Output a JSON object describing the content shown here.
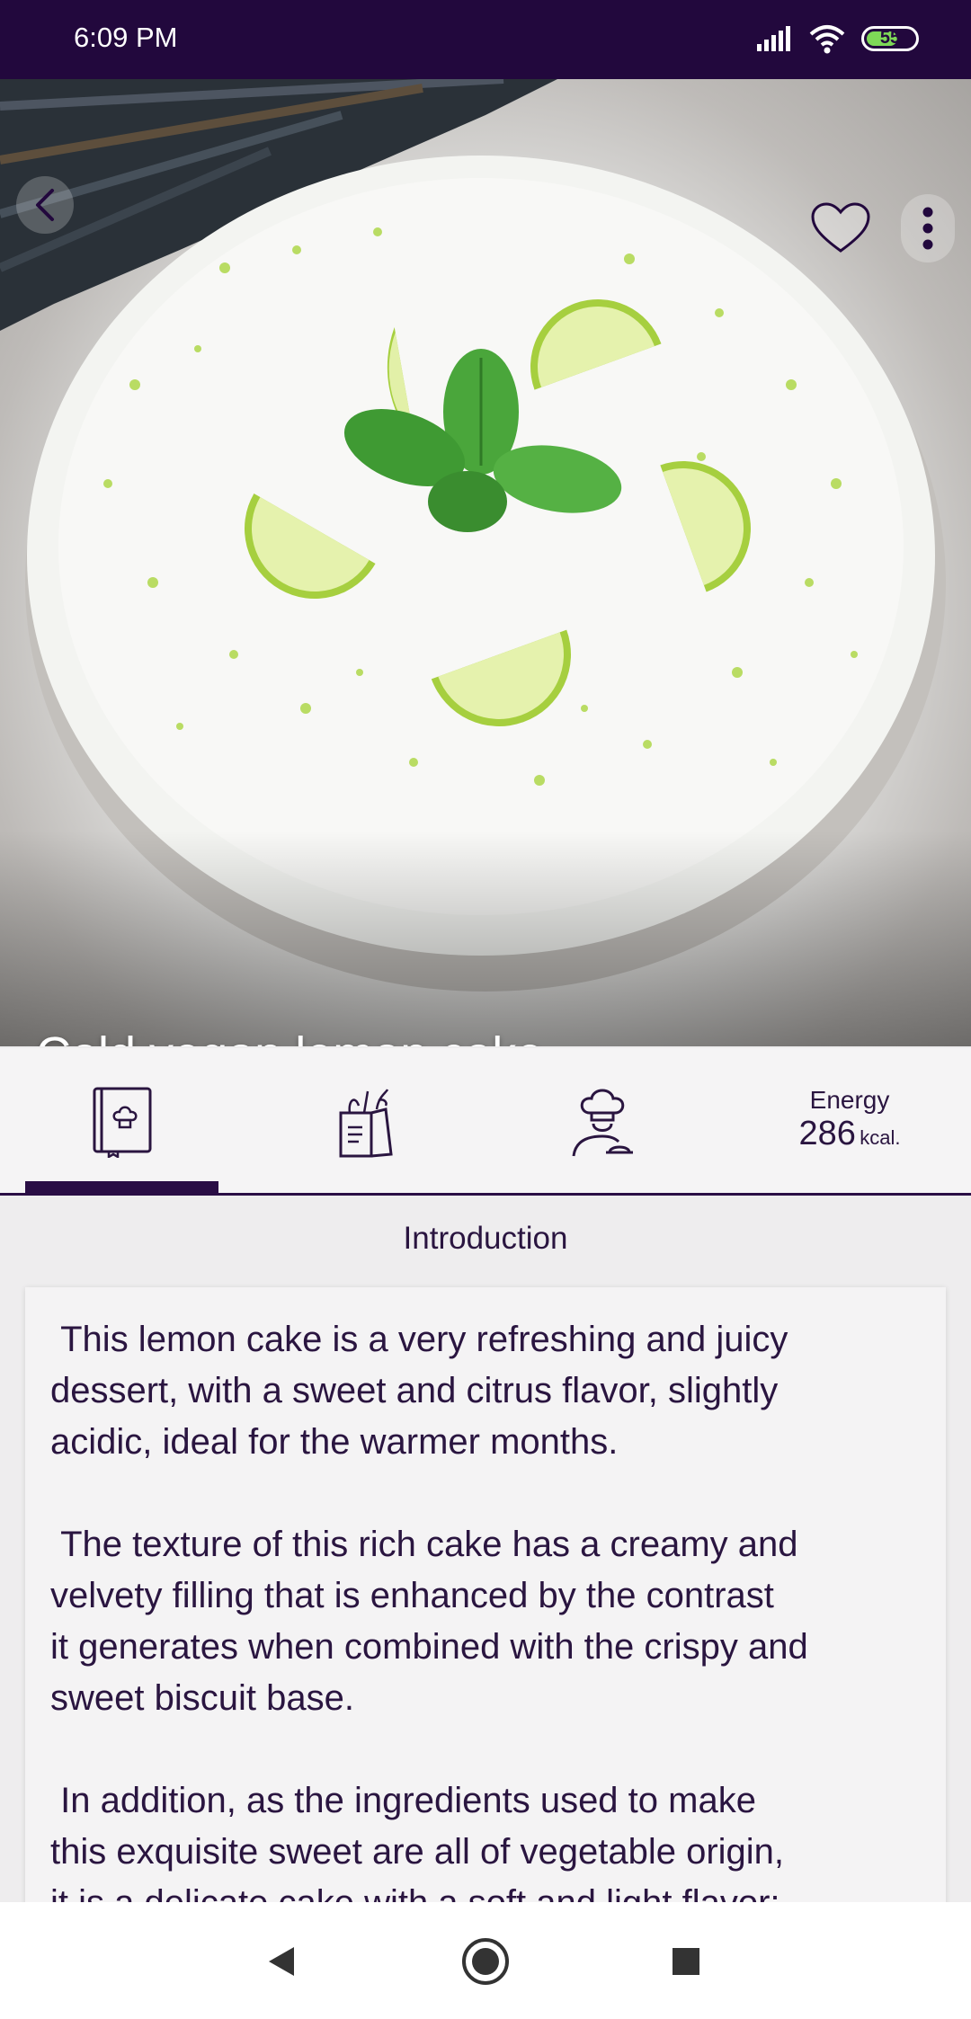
{
  "status_bar": {
    "time": "6:09 PM",
    "battery": "55",
    "icons": [
      "signal-icon",
      "wifi-icon",
      "battery-icon"
    ]
  },
  "header": {
    "back_icon": "chevron-left-icon",
    "favorite_icon": "heart-outline-icon",
    "more_icon": "more-vertical-icon",
    "title": "Cold vegan lemon cake"
  },
  "tabs": [
    {
      "icon": "recipe-book-icon",
      "selected": true
    },
    {
      "icon": "ingredients-bag-icon",
      "selected": false
    },
    {
      "icon": "chef-icon",
      "selected": false
    }
  ],
  "energy": {
    "label": "Energy",
    "value": "286",
    "unit": "kcal."
  },
  "section": {
    "title": "Introduction"
  },
  "introduction": " This lemon cake is a very refreshing and juicy\ndessert, with a sweet and citrus flavor, slightly\nacidic, ideal for the warmer months.\n\n The texture of this rich cake has a creamy and\nvelvety filling that is enhanced by the contrast\nit generates when combined with the crispy and\nsweet biscuit base.\n\n In addition, as the ingredients used to make\nthis exquisite sweet are all of vegetable origin,\nit is a delicate cake with a soft and light flavor;",
  "colors": {
    "primary": "#22083d",
    "accent_text": "#2a1540",
    "lime": "#b9dc63",
    "mint": "#4aa63b"
  },
  "nav": [
    "back-triangle-icon",
    "home-circle-icon",
    "recents-square-icon"
  ]
}
